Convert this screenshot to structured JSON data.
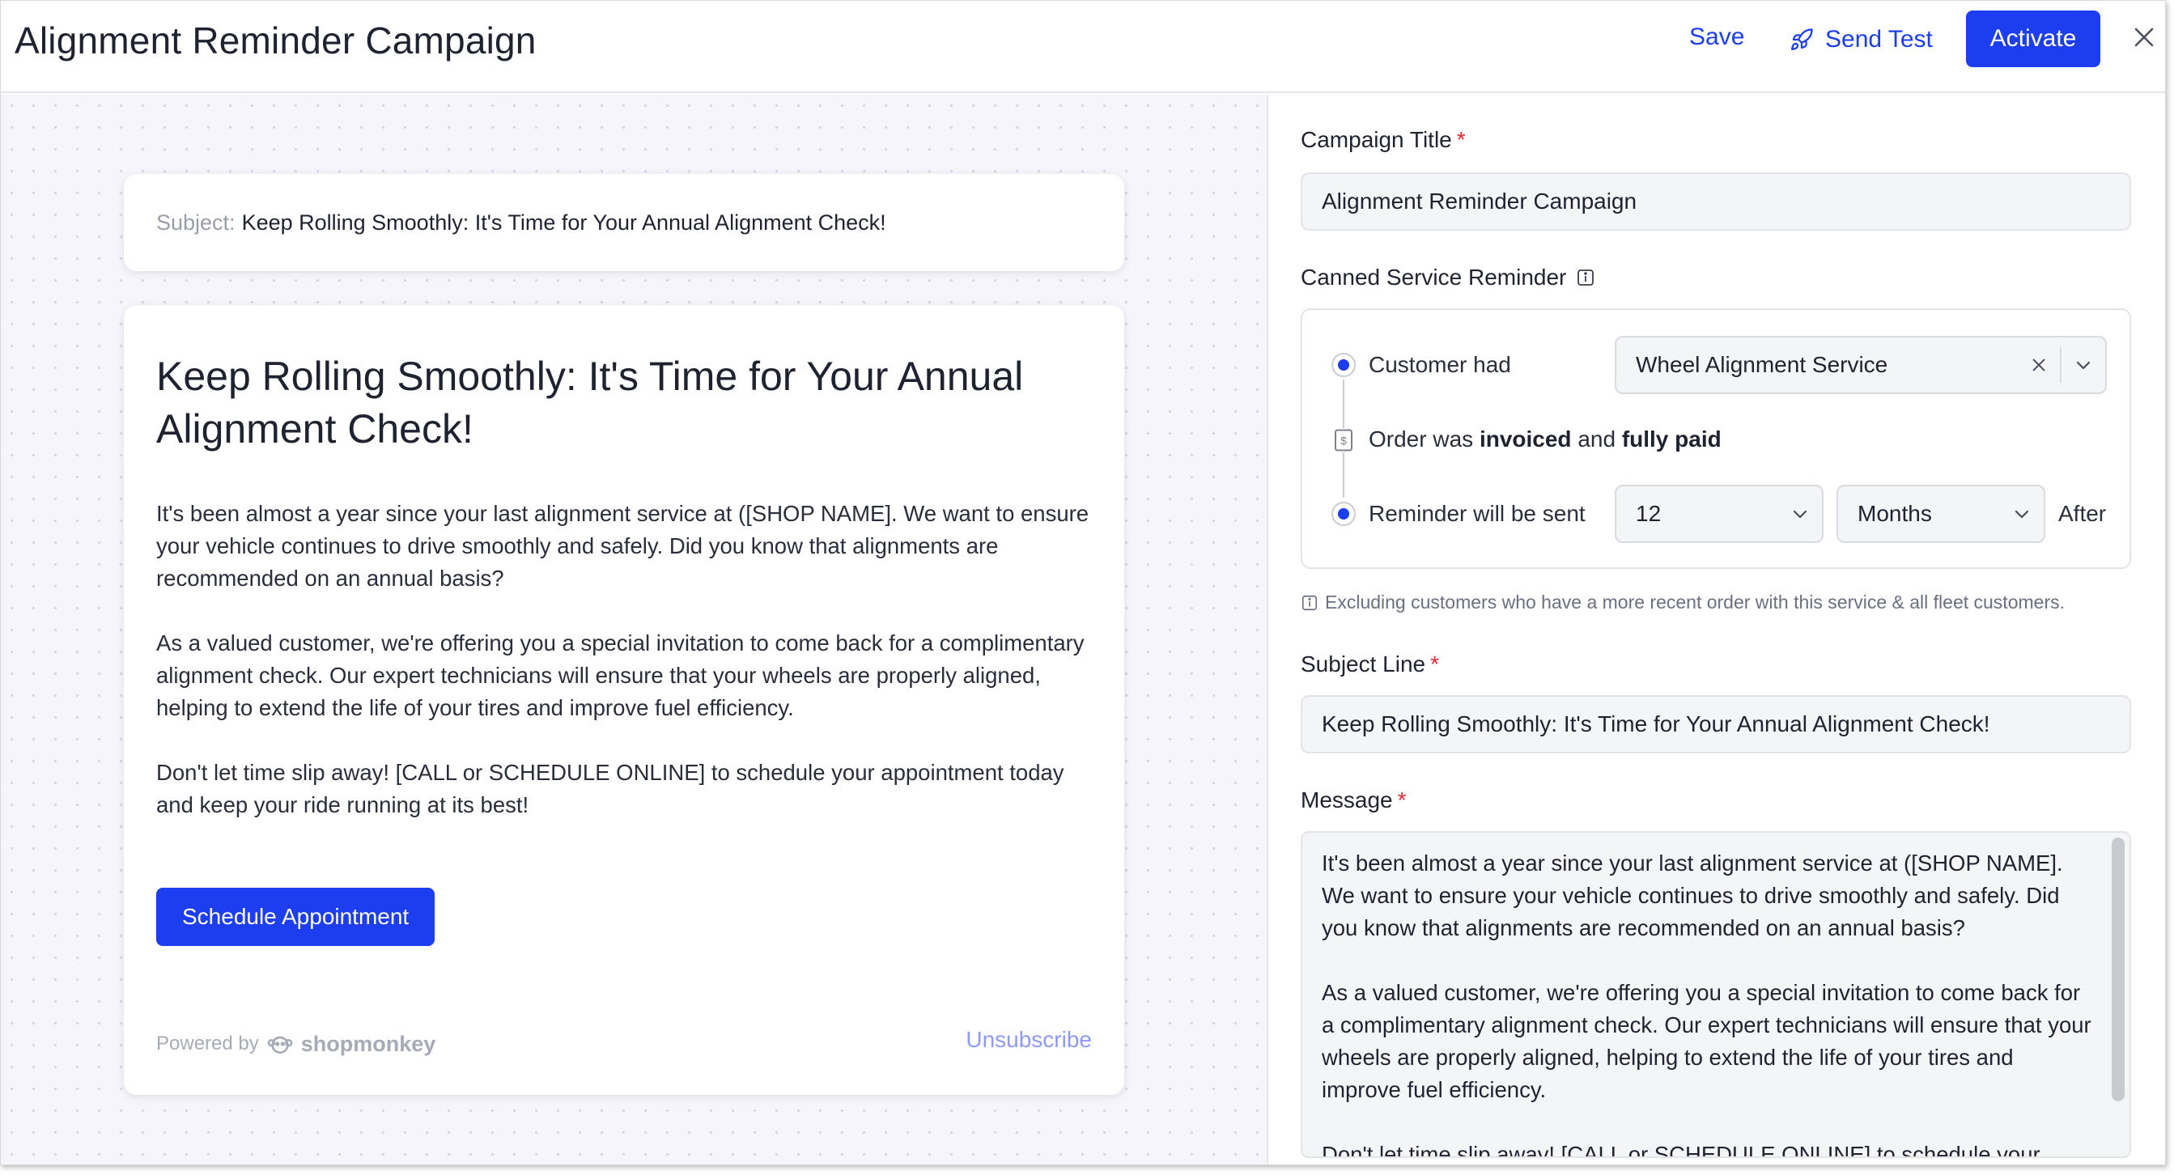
{
  "header": {
    "title": "Alignment Reminder Campaign",
    "save_label": "Save",
    "send_test_label": "Send Test",
    "activate_label": "Activate"
  },
  "preview": {
    "subject_label": "Subject:",
    "subject_text": "Keep Rolling Smoothly: It's Time for Your Annual Alignment Check!",
    "heading": "Keep Rolling Smoothly: It's Time for Your Annual Alignment Check!",
    "paragraphs": [
      "It's been almost a year since your last alignment service at ([SHOP NAME]. We want to ensure your vehicle continues to drive smoothly and safely. Did you know that alignments are recommended on an annual basis?",
      "As a valued customer, we're offering you a special invitation to come back for a complimentary alignment check. Our expert technicians will ensure that your wheels are properly aligned, helping to extend the life of your tires and improve fuel efficiency.",
      "Don't let time slip away! [CALL or SCHEDULE ONLINE] to schedule your appointment today and keep your ride running at its best!"
    ],
    "button_label": "Schedule Appointment",
    "powered_by": "Powered by",
    "brand": "shopmonkey",
    "unsubscribe": "Unsubscribe"
  },
  "form": {
    "campaign_title_label": "Campaign Title",
    "campaign_title_value": "Alignment Reminder Campaign",
    "canned_label": "Canned Service Reminder",
    "customer_had_label": "Customer had",
    "service_value": "Wheel Alignment Service",
    "order_prefix": "Order was",
    "order_invoiced": "invoiced",
    "order_and": "and",
    "order_paid": "fully paid",
    "reminder_label": "Reminder will be sent",
    "interval_value": "12",
    "unit_value": "Months",
    "after_label": "After",
    "excluding_note": "Excluding customers who have a more recent order with this service & all fleet customers.",
    "subject_line_label": "Subject Line",
    "subject_line_value": "Keep Rolling Smoothly: It's Time for Your Annual Alignment Check!",
    "message_label": "Message",
    "message_paragraphs": [
      "It's been almost a year since your last alignment service at ([SHOP NAME]. We want to ensure your vehicle continues to drive smoothly and safely. Did you know that alignments are recommended on an annual basis?",
      "As a valued customer, we're offering you a special invitation to come back for a complimentary alignment check. Our expert technicians will ensure that your wheels are properly aligned, helping to extend the life of your tires and improve fuel efficiency.",
      "Don't let time slip away! [CALL or SCHEDULE ONLINE] to schedule your"
    ]
  },
  "colors": {
    "primary": "#1c3ef0",
    "required": "#e0292f",
    "preview_bg": "#f5f5fb"
  },
  "icons": {
    "send_test": "rocket-icon",
    "close": "close-icon",
    "info": "info-icon",
    "invoice": "dollar-doc-icon",
    "clear": "x-icon",
    "dropdown": "chevron-down-icon",
    "brand": "monkey-logo-icon"
  }
}
